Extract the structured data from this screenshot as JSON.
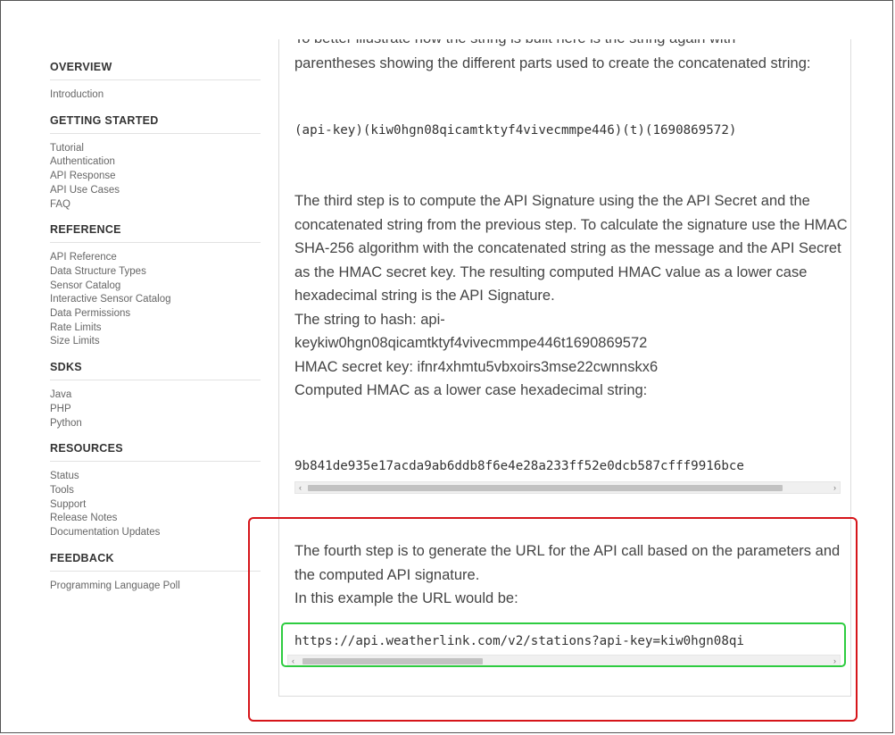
{
  "sidebar": {
    "groups": [
      {
        "title": "OVERVIEW",
        "items": [
          "Introduction"
        ]
      },
      {
        "title": "GETTING STARTED",
        "items": [
          "Tutorial",
          "Authentication",
          "API Response",
          "API Use Cases",
          "FAQ"
        ]
      },
      {
        "title": "REFERENCE",
        "items": [
          "API Reference",
          "Data Structure Types",
          "Sensor Catalog",
          "Interactive Sensor Catalog",
          "Data Permissions",
          "Rate Limits",
          "Size Limits"
        ]
      },
      {
        "title": "SDKS",
        "items": [
          "Java",
          "PHP",
          "Python"
        ]
      },
      {
        "title": "RESOURCES",
        "items": [
          "Status",
          "Tools",
          "Support",
          "Release Notes",
          "Documentation Updates"
        ]
      },
      {
        "title": "FEEDBACK",
        "items": [
          "Programming Language Poll"
        ]
      }
    ]
  },
  "content": {
    "clipped_line": "To better illustrate how the string is built here is the string again with",
    "intro_rest": "parentheses showing the different parts used to create the concatenated string:",
    "concat_parts": "(api-key)(kiw0hgn08qicamtktyf4vivecmmpe446)(t)(1690869572)",
    "step3_para": "The third step is to compute the API Signature using the the API Secret and the concatenated string from the previous step. To calculate the signature use the HMAC SHA-256 algorithm with the concatenated string as the message and the API Secret as the HMAC secret key. The resulting computed HMAC value as a lower case hexadecimal string is the API Signature.",
    "string_to_hash_label": "The string to hash: api-",
    "string_to_hash_value": "keykiw0hgn08qicamtktyf4vivecmmpe446t1690869572",
    "hmac_key_line": "HMAC secret key: ifnr4xhmtu5vbxoirs3mse22cwnnskx6",
    "computed_label": "Computed HMAC as a lower case hexadecimal string:",
    "hmac_value": "9b841de935e17acda9ab6ddb8f6e4e28a233ff52e0dcb587cfff9916bce",
    "step4_para": "The fourth step is to generate the URL for the API call based on the parameters and the computed API signature.",
    "example_label": "In this example the URL would be:",
    "url_value": "https://api.weatherlink.com/v2/stations?api-key=kiw0hgn08qi"
  },
  "scrollbars": {
    "left_arrow": "‹",
    "right_arrow": "›"
  },
  "colors": {
    "highlight_red": "#d6151a",
    "highlight_green": "#2ecc40"
  }
}
